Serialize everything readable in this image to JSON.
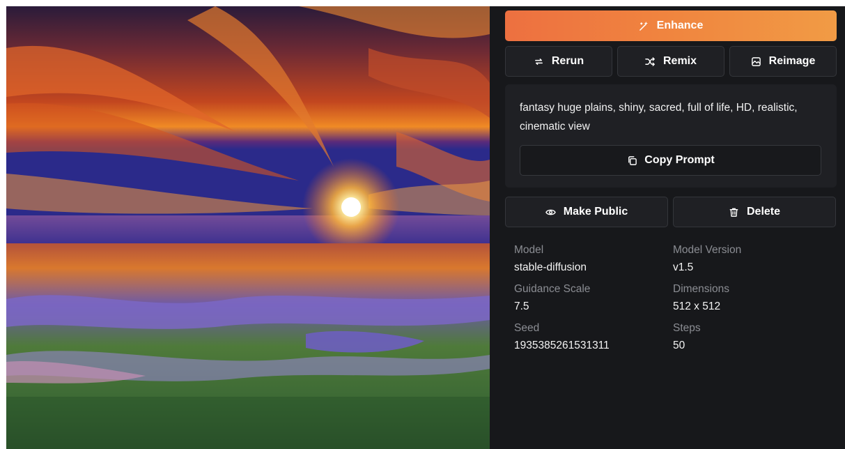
{
  "image": {
    "description_icon": "generated-landscape-image"
  },
  "actions": {
    "enhance_label": "Enhance",
    "rerun_label": "Rerun",
    "remix_label": "Remix",
    "reimage_label": "Reimage",
    "make_public_label": "Make Public",
    "delete_label": "Delete",
    "copy_prompt_label": "Copy Prompt"
  },
  "prompt": {
    "text": "fantasy huge plains, shiny, sacred, full of life, HD, realistic, cinematic view"
  },
  "details": {
    "model_label": "Model",
    "model_value": "stable-diffusion",
    "model_version_label": "Model Version",
    "model_version_value": "v1.5",
    "guidance_label": "Guidance Scale",
    "guidance_value": "7.5",
    "dimensions_label": "Dimensions",
    "dimensions_value": "512 x 512",
    "seed_label": "Seed",
    "seed_value": "1935385261531311",
    "steps_label": "Steps",
    "steps_value": "50"
  },
  "icons": {
    "enhance": "magic-wand-icon",
    "rerun": "repeat-icon",
    "remix": "shuffle-icon",
    "reimage": "image-icon",
    "copy": "copy-icon",
    "make_public": "eye-icon",
    "delete": "trash-icon"
  },
  "colors": {
    "background": "#17181b",
    "panel": "#1f2024",
    "accent_start": "#ed7040",
    "accent_end": "#f19b45",
    "muted_text": "#8b8d93"
  }
}
